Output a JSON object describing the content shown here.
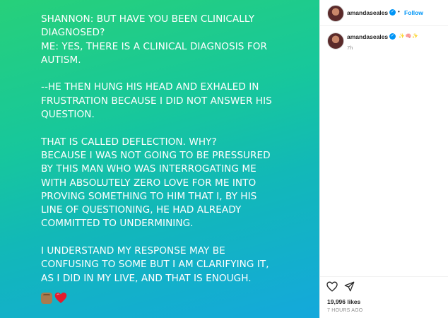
{
  "post": {
    "paragraphs": [
      "SHANNON: BUT HAVE YOU BEEN CLINICALLY DIAGNOSED? ME: YES, THERE IS A CLINICAL DIAGNOSIS FOR AUTISM.",
      "--HE THEN HUNG HIS HEAD AND EXHALED IN FRUSTRATION BECAUSE I DID NOT ANSWER HIS QUESTION.",
      "THAT IS CALLED DEFLECTION. WHY? BECAUSE I WAS NOT GOING TO BE PRESSURED BY THIS MAN WHO WAS INTERROGATING ME WITH ABSOLUTELY ZERO LOVE FOR ME INTO PROVING SOMETHING TO HIM THAT I, BY HIS LINE OF QUESTIONING, HE HAD ALREADY COMMITTED TO UNDERMINING.",
      "I UNDERSTAND MY RESPONSE MAY BE CONFUSING TO SOME BUT I AM CLARIFYING IT, AS I DID IN MY LIVE, AND THAT IS ENOUGH."
    ],
    "lines": [
      "SHANNON: BUT HAVE YOU BEEN CLINICALLY",
      "DIAGNOSED?",
      "ME: YES, THERE IS A CLINICAL DIAGNOSIS FOR",
      "AUTISM.",
      "--HE THEN HUNG HIS HEAD AND EXHALED IN",
      "FRUSTRATION BECAUSE I DID NOT ANSWER HIS",
      "QUESTION.",
      "THAT IS CALLED DEFLECTION. WHY?",
      "BECAUSE I WAS NOT GOING TO BE PRESSURED",
      "BY THIS MAN WHO WAS INTERROGATING ME",
      "WITH ABSOLUTELY ZERO LOVE FOR ME INTO",
      "PROVING SOMETHING TO HIM THAT I, BY HIS",
      "LINE OF QUESTIONING, HE HAD ALREADY",
      "COMMITTED TO UNDERMINING.",
      "I UNDERSTAND MY RESPONSE MAY BE",
      "CONFUSING TO SOME BUT I AM CLARIFYING IT,",
      "AS I DID IN MY LIVE, AND THAT IS ENOUGH."
    ],
    "emojis": [
      "raised-fist-emoji",
      "red-heart-emoji"
    ],
    "gradient_colors": [
      "#27d07a",
      "#17c79c",
      "#12b8b8",
      "#14a8dc"
    ]
  },
  "header": {
    "username": "amandaseales",
    "separator": "•",
    "follow_label": "Follow"
  },
  "caption": {
    "username": "amandaseales",
    "emojis": "✨🧠✨",
    "timestamp": "7h"
  },
  "actions": {
    "icons": [
      "heart-icon",
      "share-icon"
    ],
    "likes": "19,996 likes",
    "time_ago": "7 HOURS AGO"
  },
  "colors": {
    "accent": "#0095f6",
    "text": "#262626",
    "muted": "#8e8e8e"
  }
}
